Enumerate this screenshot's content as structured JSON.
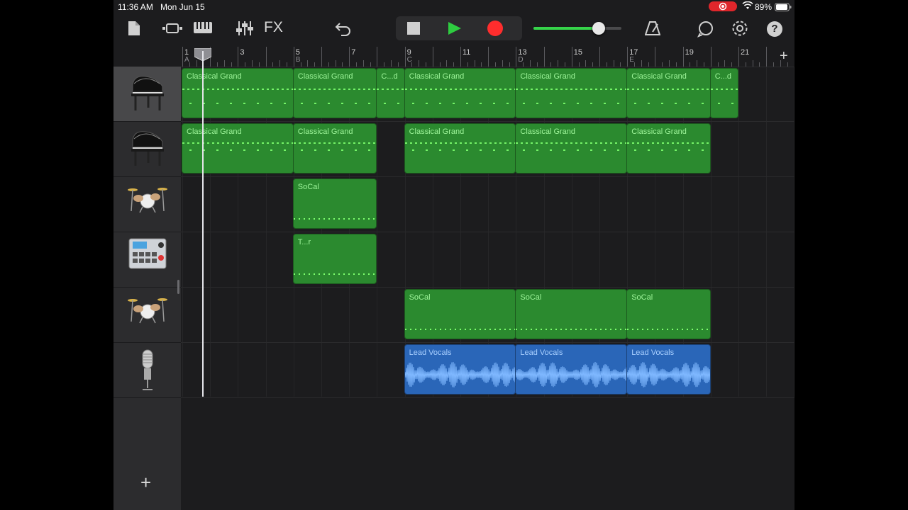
{
  "status_bar": {
    "time": "11:36 AM",
    "date": "Mon Jun 15",
    "battery": "89%"
  },
  "toolbar": {
    "fx_label": "FX",
    "icons": [
      "document-icon",
      "track-view-icon",
      "keyboard-icon",
      "mixer-icon",
      "undo-icon",
      "stop-icon",
      "play-icon",
      "record-icon",
      "metronome-icon",
      "loop-icon",
      "settings-icon",
      "help-icon"
    ],
    "help_label": "?",
    "master_volume": 0.74
  },
  "colors": {
    "midi_region": "#2b8a2f",
    "audio_region": "#2a66b8",
    "play": "#2ecc40",
    "record": "#ff2d2d",
    "volume": "#36d44a"
  },
  "ruler": {
    "bars": [
      "1",
      "3",
      "5",
      "7",
      "9",
      "11",
      "13",
      "15",
      "17",
      "19",
      "21"
    ],
    "sections": [
      "A",
      "B",
      "C",
      "D",
      "E"
    ],
    "add_label": "+"
  },
  "tracks": [
    {
      "instrument": "grand-piano-icon",
      "regions": [
        {
          "name": "Classical Grand",
          "start": 1,
          "end": 5
        },
        {
          "name": "Classical Grand",
          "start": 5,
          "end": 8
        },
        {
          "name": "C...d",
          "start": 8,
          "end": 9
        },
        {
          "name": "Classical Grand",
          "start": 9,
          "end": 13
        },
        {
          "name": "Classical Grand",
          "start": 13,
          "end": 17
        },
        {
          "name": "Classical Grand",
          "start": 17,
          "end": 20
        },
        {
          "name": "C...d",
          "start": 20,
          "end": 21
        }
      ]
    },
    {
      "instrument": "grand-piano-icon",
      "regions": [
        {
          "name": "Classical Grand",
          "start": 1,
          "end": 5
        },
        {
          "name": "Classical Grand",
          "start": 5,
          "end": 8
        },
        {
          "name": "Classical Grand",
          "start": 9,
          "end": 13
        },
        {
          "name": "Classical Grand",
          "start": 13,
          "end": 17
        },
        {
          "name": "Classical Grand",
          "start": 17,
          "end": 20
        }
      ]
    },
    {
      "instrument": "drum-kit-icon",
      "regions": [
        {
          "name": "SoCal",
          "start": 5,
          "end": 8
        }
      ]
    },
    {
      "instrument": "beat-sequencer-icon",
      "regions": [
        {
          "name": "T...r",
          "start": 5,
          "end": 8
        }
      ]
    },
    {
      "instrument": "drum-kit-icon",
      "regions": [
        {
          "name": "SoCal",
          "start": 9,
          "end": 13
        },
        {
          "name": "SoCal",
          "start": 13,
          "end": 17
        },
        {
          "name": "SoCal",
          "start": 17,
          "end": 20
        }
      ]
    },
    {
      "instrument": "microphone-icon",
      "regions": [
        {
          "name": "Lead Vocals",
          "start": 9,
          "end": 13
        },
        {
          "name": "Lead Vocals",
          "start": 13,
          "end": 17
        },
        {
          "name": "Lead Vocals",
          "start": 17,
          "end": 20
        }
      ]
    }
  ],
  "playhead_bar": 1.75,
  "add_track_label": "+"
}
